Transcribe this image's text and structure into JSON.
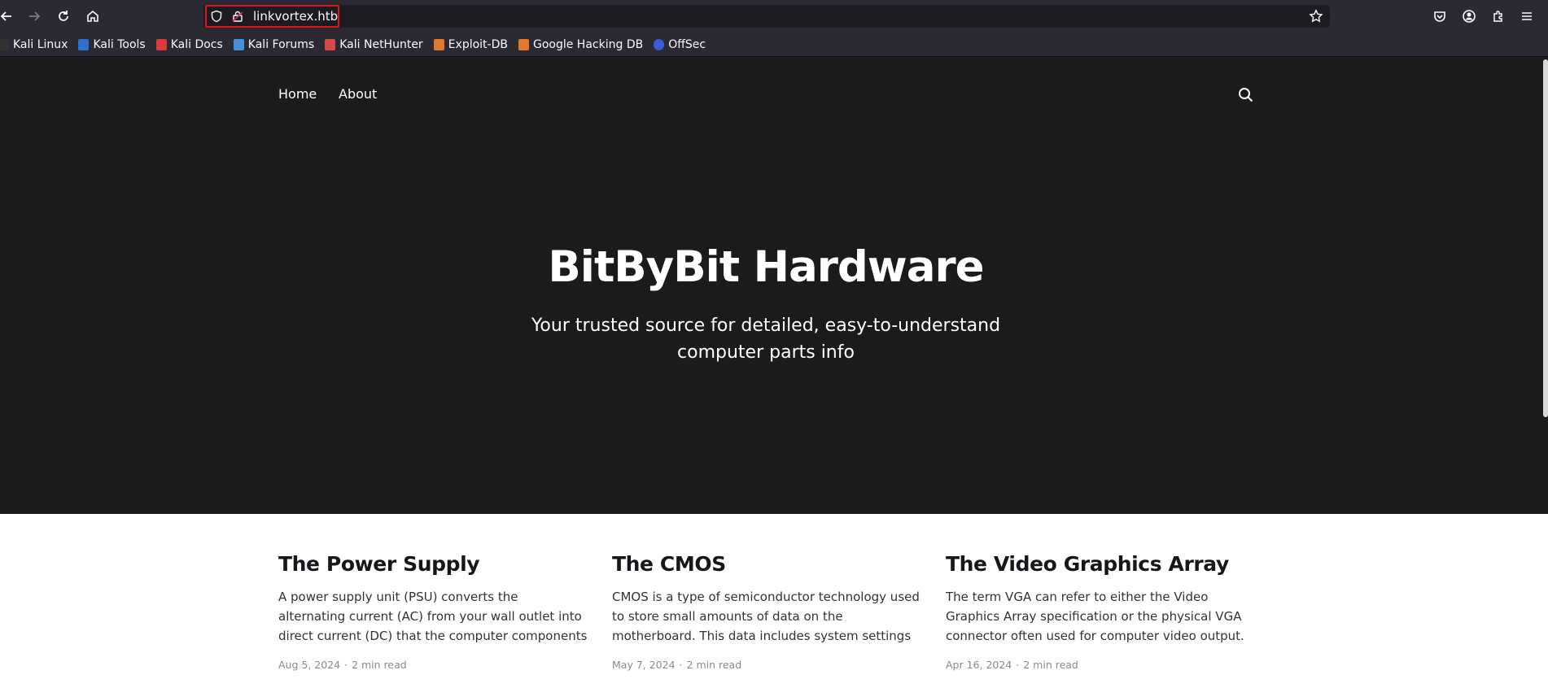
{
  "browser": {
    "url": "linkvortex.htb",
    "bookmarks": [
      {
        "label": "Kali Linux",
        "color": "#333333"
      },
      {
        "label": "Kali Tools",
        "color": "#2f6fd1"
      },
      {
        "label": "Kali Docs",
        "color": "#d93b3b"
      },
      {
        "label": "Kali Forums",
        "color": "#4a90d9"
      },
      {
        "label": "Kali NetHunter",
        "color": "#d94848"
      },
      {
        "label": "Exploit-DB",
        "color": "#e0782d"
      },
      {
        "label": "Google Hacking DB",
        "color": "#e0782d"
      },
      {
        "label": "OffSec",
        "color": "#3b5bd9"
      }
    ]
  },
  "site": {
    "nav": [
      "Home",
      "About"
    ],
    "title": "BitByBit Hardware",
    "subtitle": "Your trusted source for detailed, easy-to-understand computer parts info"
  },
  "posts": [
    {
      "title": "The Power Supply",
      "excerpt": "A power supply unit (PSU) converts the alternating current (AC) from your wall outlet into direct current (DC) that the computer components require. It…",
      "date": "Aug 5, 2024",
      "read": "2 min read"
    },
    {
      "title": "The CMOS",
      "excerpt": "CMOS is a type of semiconductor technology used to store small amounts of data on the motherboard. This data includes system settings and configuratio…",
      "date": "May 7, 2024",
      "read": "2 min read"
    },
    {
      "title": "The Video Graphics Array",
      "excerpt": "The term VGA can refer to either the Video Graphics Array specification or the physical VGA connector often used for computer video output. Below, I'll…",
      "date": "Apr 16, 2024",
      "read": "2 min read"
    }
  ]
}
